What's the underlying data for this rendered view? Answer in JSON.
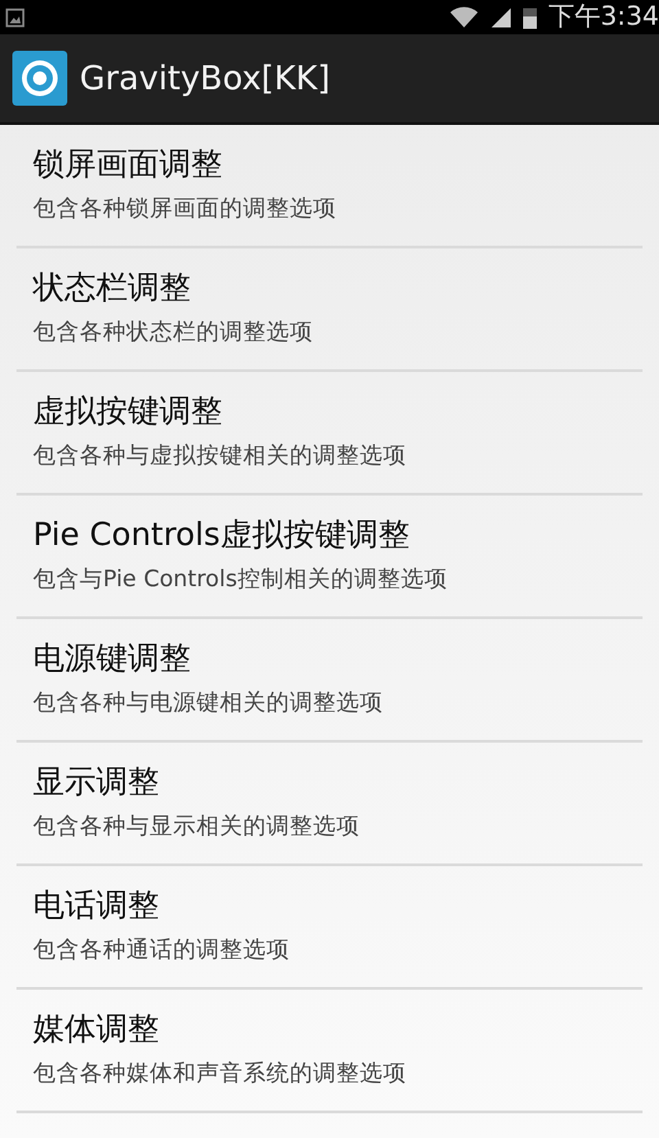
{
  "status_bar": {
    "time": "下午3:34"
  },
  "action_bar": {
    "title": "GravityBox[KK]"
  },
  "items": [
    {
      "title": "锁屏画面调整",
      "summary": "包含各种锁屏画面的调整选项"
    },
    {
      "title": "状态栏调整",
      "summary": "包含各种状态栏的调整选项"
    },
    {
      "title": "虚拟按键调整",
      "summary": "包含各种与虚拟按键相关的调整选项"
    },
    {
      "title": "Pie Controls虚拟按键调整",
      "summary": "包含与Pie Controls控制相关的调整选项"
    },
    {
      "title": "电源键调整",
      "summary": "包含各种与电源键相关的调整选项"
    },
    {
      "title": "显示调整",
      "summary": "包含各种与显示相关的调整选项"
    },
    {
      "title": "电话调整",
      "summary": "包含各种通话的调整选项"
    },
    {
      "title": "媒体调整",
      "summary": "包含各种媒体和声音系统的调整选项"
    }
  ]
}
